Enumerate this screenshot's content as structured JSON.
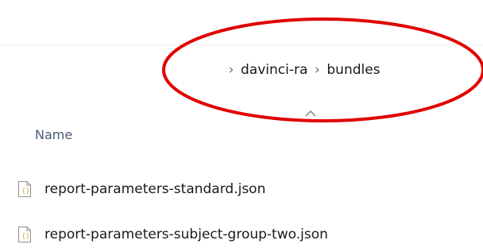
{
  "breadcrumb": {
    "separator": "›",
    "items": [
      {
        "label": "davinci-ra"
      },
      {
        "label": "bundles"
      }
    ]
  },
  "column_header": {
    "name_label": "Name",
    "sort": "ascending"
  },
  "files": [
    {
      "name": "report-parameters-standard.json",
      "icon": "json-file-icon"
    },
    {
      "name": "report-parameters-subject-group-two.json",
      "icon": "json-file-icon"
    }
  ],
  "annotation": {
    "shape": "ellipse",
    "color": "#e00000"
  },
  "colors": {
    "header_text": "#4b5a78",
    "file_icon_accent": "#c9b248"
  }
}
